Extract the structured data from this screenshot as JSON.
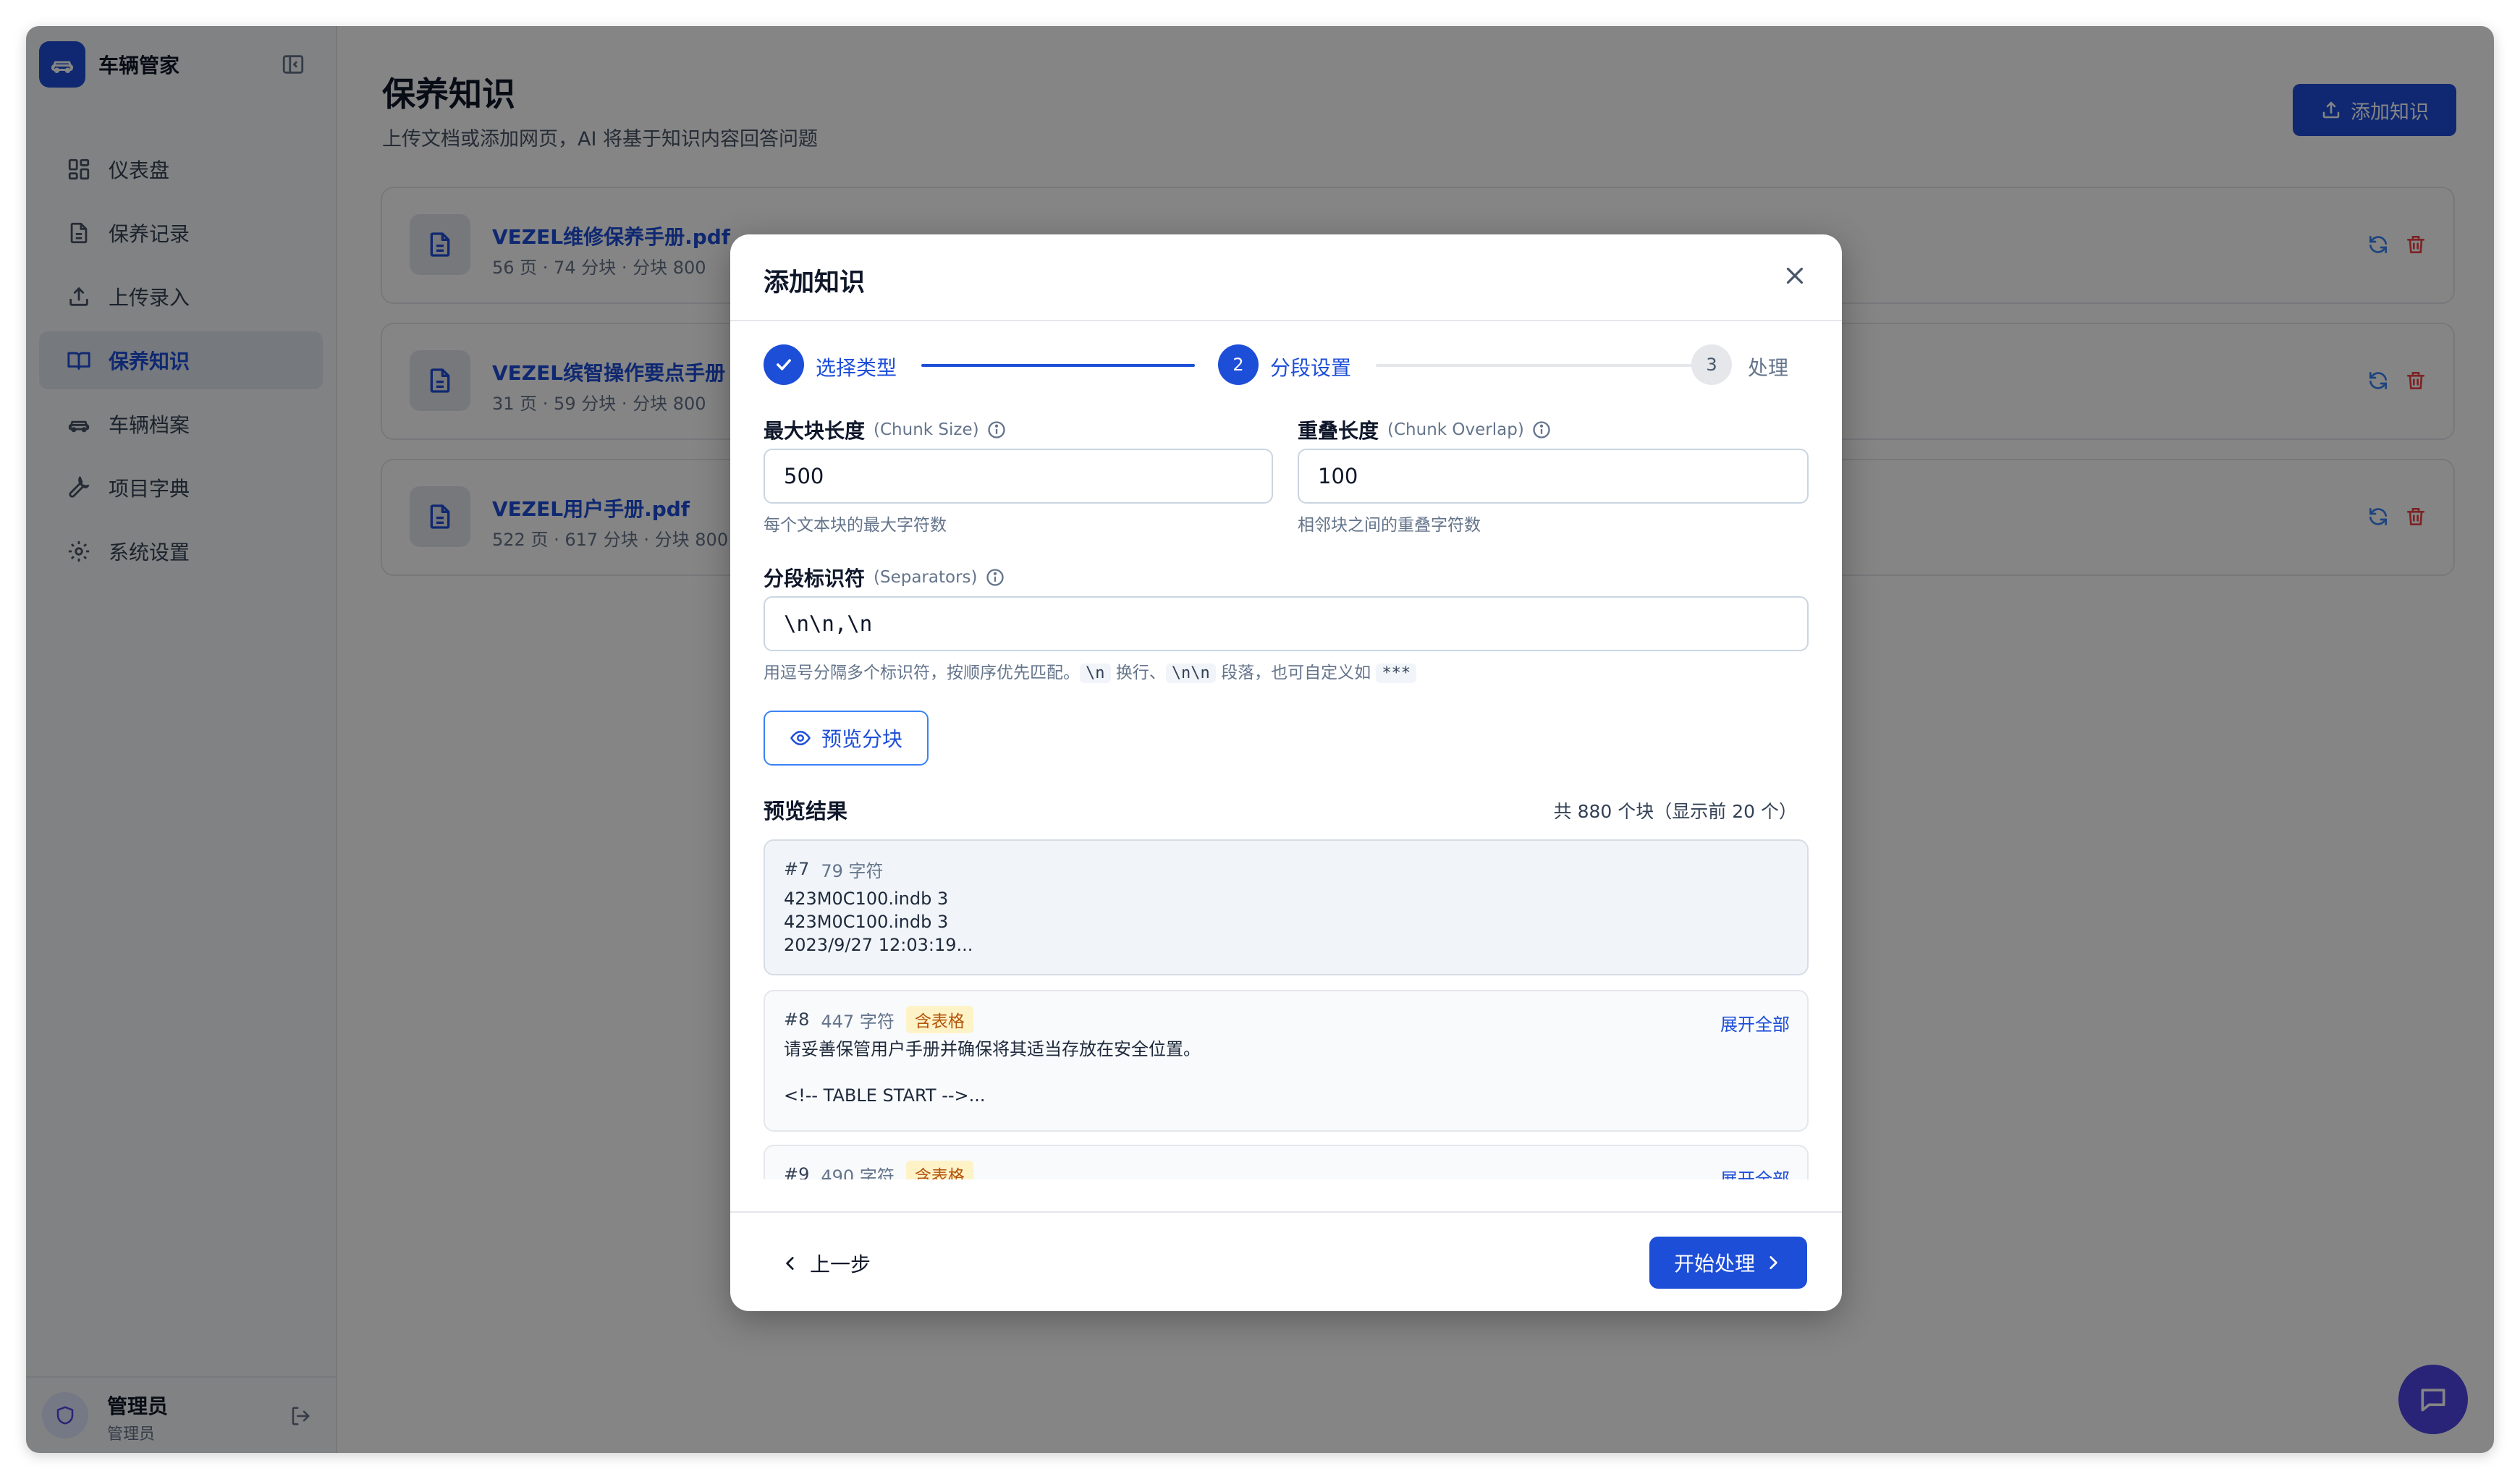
{
  "sidebar": {
    "app_name": "车辆管家",
    "items": [
      {
        "label": "仪表盘",
        "icon": "dashboard-icon"
      },
      {
        "label": "保养记录",
        "icon": "document-icon"
      },
      {
        "label": "上传录入",
        "icon": "upload-icon"
      },
      {
        "label": "保养知识",
        "icon": "book-icon",
        "active": true
      },
      {
        "label": "车辆档案",
        "icon": "car-icon"
      },
      {
        "label": "项目字典",
        "icon": "wrench-icon"
      },
      {
        "label": "系统设置",
        "icon": "gear-icon"
      }
    ],
    "user": {
      "name": "管理员",
      "role": "管理员"
    }
  },
  "page": {
    "title": "保养知识",
    "subtitle": "上传文档或添加网页，AI 将基于知识内容回答问题",
    "add_button": "添加知识"
  },
  "knowledge_items": [
    {
      "name": "VEZEL维修保养手册.pdf",
      "meta": "56 页 · 74 分块 · 分块 800"
    },
    {
      "name": "VEZEL缤智操作要点手册",
      "meta": "31 页 · 59 分块 · 分块 800"
    },
    {
      "name": "VEZEL用户手册.pdf",
      "meta": "522 页 · 617 分块 · 分块 800"
    }
  ],
  "modal": {
    "title": "添加知识",
    "steps": [
      {
        "label": "选择类型",
        "number": "1",
        "state": "done"
      },
      {
        "label": "分段设置",
        "number": "2",
        "state": "current"
      },
      {
        "label": "处理",
        "number": "3",
        "state": "todo"
      }
    ],
    "chunk_size": {
      "label": "最大块长度",
      "en": "(Chunk Size)",
      "value": "500",
      "hint": "每个文本块的最大字符数"
    },
    "chunk_overlap": {
      "label": "重叠长度",
      "en": "(Chunk Overlap)",
      "value": "100",
      "hint": "相邻块之间的重叠字符数"
    },
    "separators": {
      "label": "分段标识符",
      "en": "(Separators)",
      "value": "\\n\\n,\\n",
      "hint_part1": "用逗号分隔多个标识符，按顺序优先匹配。",
      "hint_code1": "\\n",
      "hint_part2": "换行、",
      "hint_code2": "\\n\\n",
      "hint_part3": "段落，也可自定义如",
      "hint_code3": "***"
    },
    "preview_button": "预览分块",
    "preview_title": "预览结果",
    "preview_count": "共 880 个块（显示前 20 个）",
    "chunks": [
      {
        "index": "#7",
        "chars": "79 字符",
        "has_table": false,
        "text": "423M0C100.indb   3\n423M0C100.indb   3\n2023/9/27   12:03:19..."
      },
      {
        "index": "#8",
        "chars": "447 字符",
        "has_table": true,
        "badge": "含表格",
        "expand": "展开全部",
        "text": "请妥善保管用户手册并确保将其适当存放在安全位置。\n\n<!-- TABLE START -->..."
      },
      {
        "index": "#9",
        "chars": "490 字符",
        "has_table": true,
        "badge": "含表格",
        "expand": "展开全部",
        "text": ""
      }
    ],
    "prev_button": "上一步",
    "start_button": "开始处理"
  },
  "colors": {
    "primary": "#1d4ed8",
    "badge_bg": "#fef3c7",
    "badge_text": "#b45309",
    "fab": "#4f46e5"
  }
}
